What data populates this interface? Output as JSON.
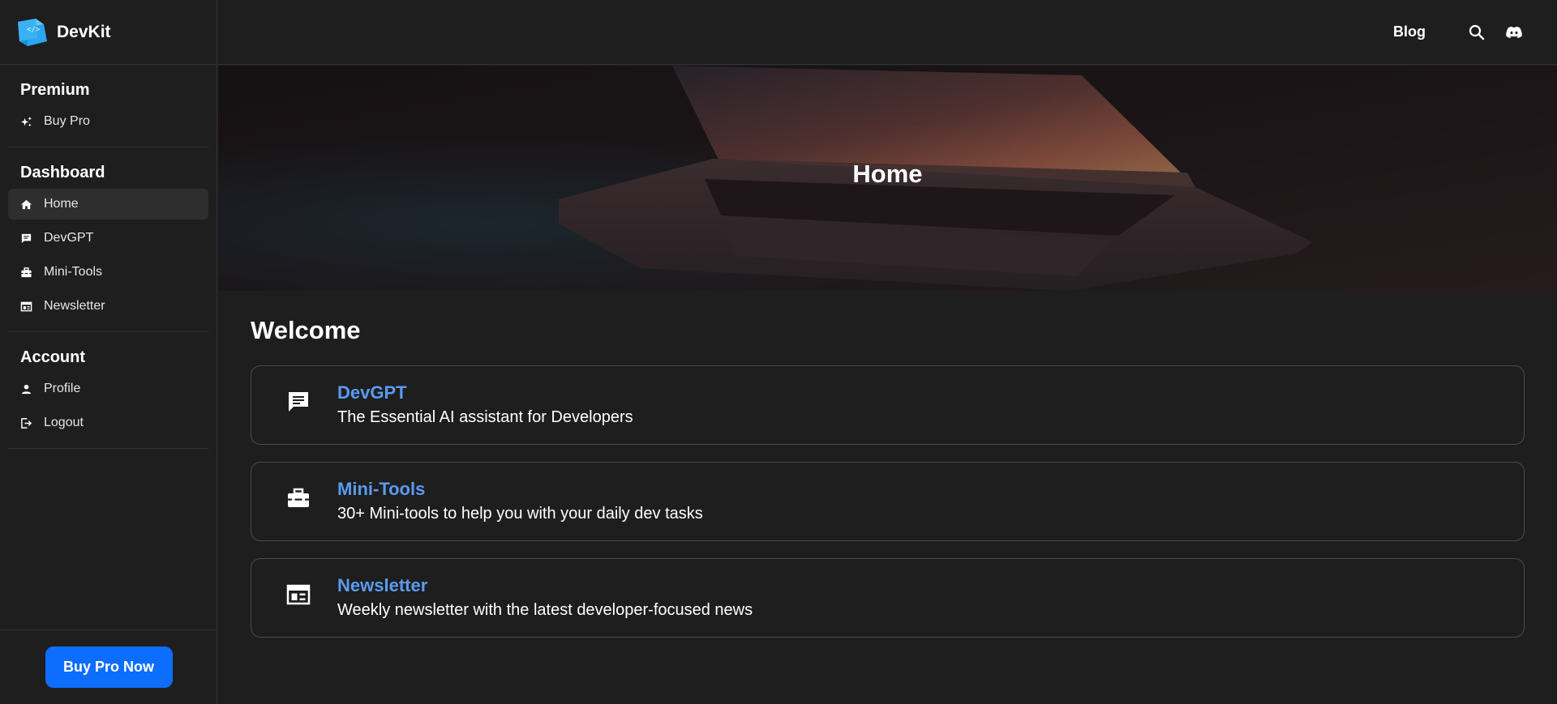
{
  "brand": {
    "name": "DevKit",
    "logo_icon": "code-cube-icon"
  },
  "sidebar": {
    "sections": [
      {
        "heading": "Premium",
        "items": [
          {
            "label": "Buy Pro",
            "icon": "sparkle-icon"
          }
        ]
      },
      {
        "heading": "Dashboard",
        "items": [
          {
            "label": "Home",
            "icon": "home-icon",
            "active": true
          },
          {
            "label": "DevGPT",
            "icon": "chat-icon"
          },
          {
            "label": "Mini-Tools",
            "icon": "toolbox-icon"
          },
          {
            "label": "Newsletter",
            "icon": "newsletter-icon"
          }
        ]
      },
      {
        "heading": "Account",
        "items": [
          {
            "label": "Profile",
            "icon": "person-icon"
          },
          {
            "label": "Logout",
            "icon": "logout-icon"
          }
        ]
      }
    ],
    "cta_label": "Buy Pro Now"
  },
  "topbar": {
    "blog_label": "Blog",
    "search_icon": "search-icon",
    "discord_icon": "discord-icon"
  },
  "hero": {
    "title": "Home"
  },
  "main": {
    "welcome": "Welcome",
    "cards": [
      {
        "title": "DevGPT",
        "description": "The Essential AI assistant for Developers",
        "icon": "chat-icon"
      },
      {
        "title": "Mini-Tools",
        "description": "30+ Mini-tools to help you with your daily dev tasks",
        "icon": "toolbox-icon"
      },
      {
        "title": "Newsletter",
        "description": "Weekly newsletter with the latest developer-focused news",
        "icon": "newsletter-icon"
      }
    ]
  },
  "colors": {
    "background": "#1e1e1e",
    "accent": "#0d6efd",
    "card_title": "#5a9bf0",
    "border": "#4a4a4a"
  }
}
